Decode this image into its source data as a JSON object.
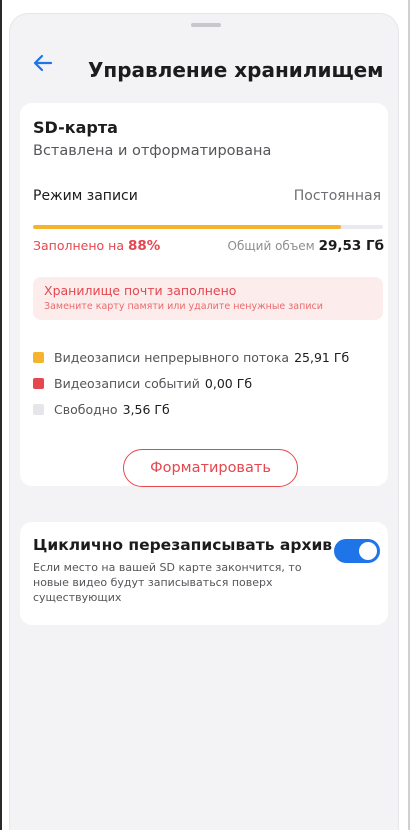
{
  "header": {
    "back_icon": "arrow-left-icon",
    "title": "Управление хранилищем"
  },
  "sd_card": {
    "title": "SD-карта",
    "status": "Вставлена и отформатирована",
    "mode_label": "Режим записи",
    "mode_value": "Постоянная",
    "filled_prefix": "Заполнено на",
    "filled_percent": "88%",
    "filled_fraction": 0.88,
    "total_label": "Общий объем",
    "total_value": "29,53 Гб",
    "alert": {
      "title": "Хранилище почти заполнено",
      "subtitle": "Замените карту памяти или удалите ненужные записи"
    },
    "legend": [
      {
        "label": "Видеозаписи непрерывного потока",
        "value": "25,91 Гб",
        "color": "#f5b32e"
      },
      {
        "label": "Видеозаписи событий",
        "value": "0,00 Гб",
        "color": "#e5474f"
      },
      {
        "label": "Свободно",
        "value": "3,56 Гб",
        "color": "#e6e6ea"
      }
    ],
    "format_button": "Форматировать"
  },
  "cyclic": {
    "title": "Циклично перезаписывать архив",
    "description": "Если место на вашей SD карте закончится, то новые видео будут записываться поверх существующих",
    "toggle_on": true
  },
  "colors": {
    "accent": "#1f74e7",
    "warning": "#e5474f",
    "progress": "#f5b32e"
  }
}
